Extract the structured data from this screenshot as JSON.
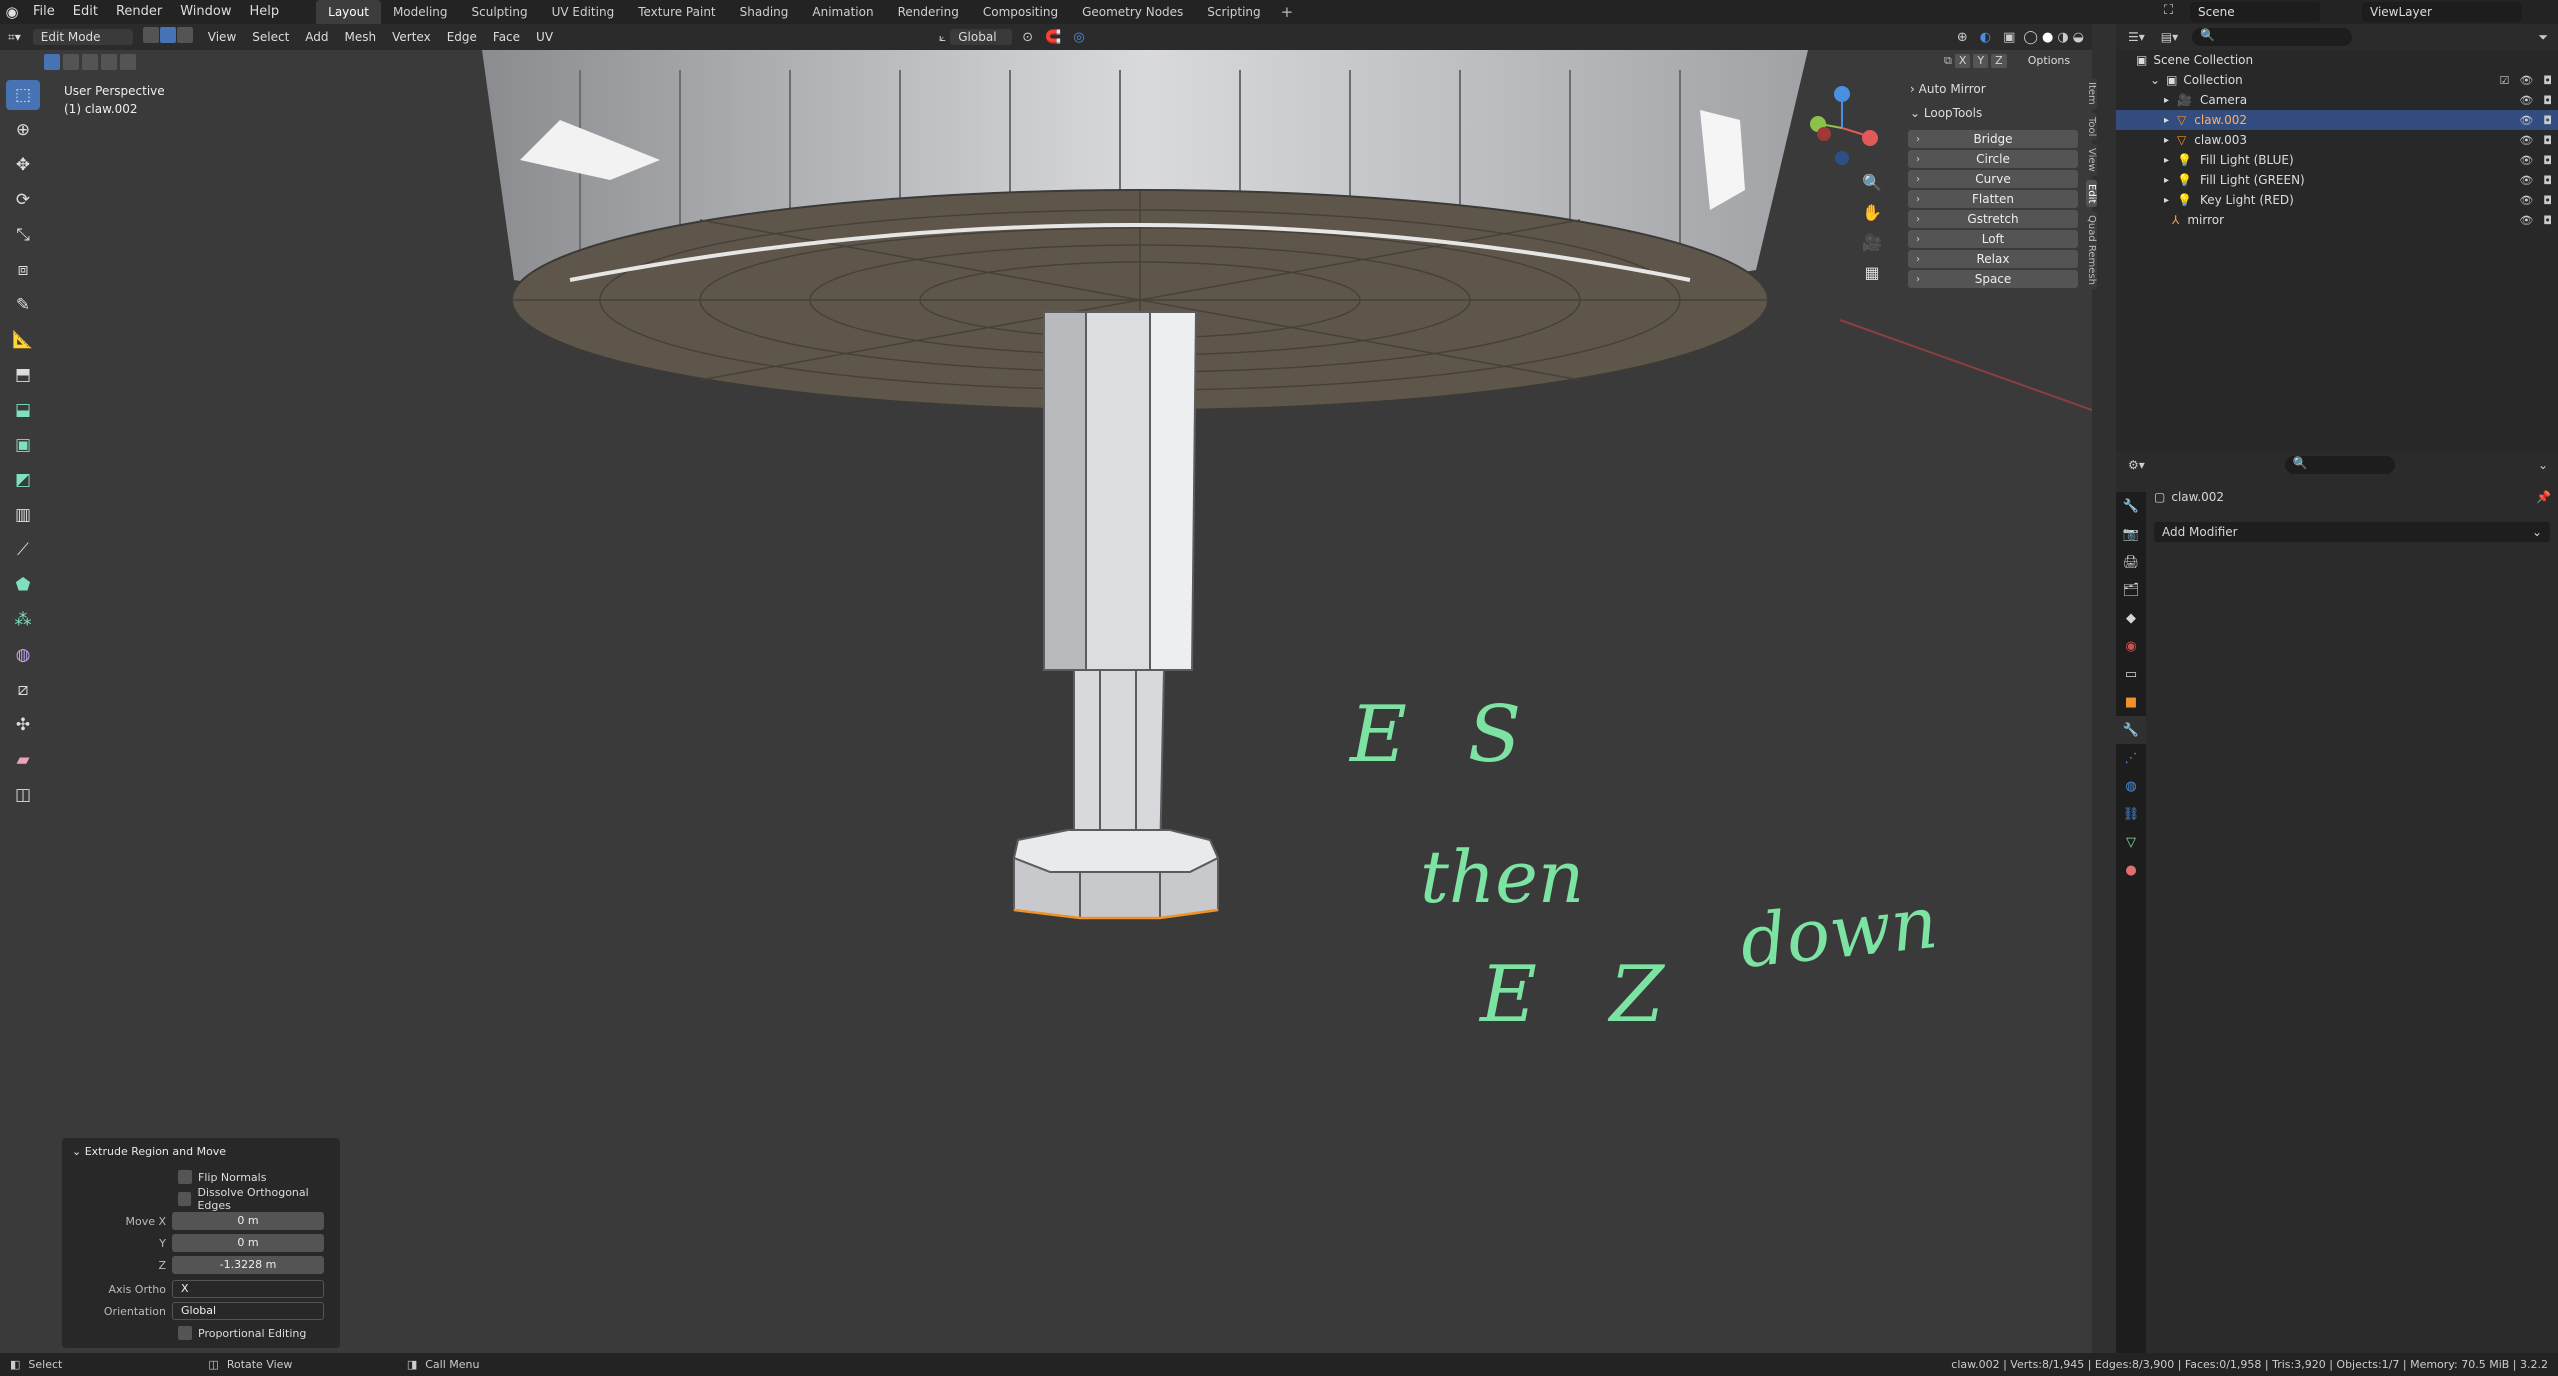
{
  "topbar": {
    "menus": [
      "File",
      "Edit",
      "Render",
      "Window",
      "Help"
    ],
    "workspaces": [
      "Layout",
      "Modeling",
      "Sculpting",
      "UV Editing",
      "Texture Paint",
      "Shading",
      "Animation",
      "Rendering",
      "Compositing",
      "Geometry Nodes",
      "Scripting"
    ],
    "active_workspace": "Layout",
    "scene": "Scene",
    "view_layer": "ViewLayer"
  },
  "viewport_header": {
    "mode": "Edit Mode",
    "menus": [
      "View",
      "Select",
      "Add",
      "Mesh",
      "Vertex",
      "Edge",
      "Face",
      "UV"
    ],
    "orientation": "Global",
    "axes": [
      "X",
      "Y",
      "Z"
    ],
    "options_label": "Options"
  },
  "viewport": {
    "perspective": "User Perspective",
    "object_label": "(1) claw.002",
    "annotations": [
      "E S",
      "then",
      "E Z",
      "down"
    ],
    "annotation_color": "#7de3a3"
  },
  "sidebar": {
    "auto_mirror": "Auto Mirror",
    "looptools_title": "LoopTools",
    "looptools": [
      "Bridge",
      "Circle",
      "Curve",
      "Flatten",
      "Gstretch",
      "Loft",
      "Relax",
      "Space"
    ],
    "tabs": [
      "Item",
      "Tool",
      "View",
      "Edit",
      "Quad Remesh"
    ]
  },
  "operator_panel": {
    "title": "Extrude Region and Move",
    "flip_normals": "Flip Normals",
    "dissolve": "Dissolve Orthogonal Edges",
    "move_x_label": "Move X",
    "move_x": "0 m",
    "y_label": "Y",
    "move_y": "0 m",
    "z_label": "Z",
    "move_z": "-1.3228 m",
    "axis_ortho_label": "Axis Ortho",
    "axis_ortho": "X",
    "orientation_label": "Orientation",
    "orientation": "Global",
    "proportional": "Proportional Editing"
  },
  "outliner": {
    "scene_collection": "Scene Collection",
    "collection": "Collection",
    "items": [
      {
        "name": "Camera",
        "icon": "camera-icon",
        "selected": false
      },
      {
        "name": "claw.002",
        "icon": "mesh-icon",
        "selected": true
      },
      {
        "name": "claw.003",
        "icon": "mesh-icon",
        "selected": false
      },
      {
        "name": "Fill Light (BLUE)",
        "icon": "light-icon",
        "selected": false
      },
      {
        "name": "Fill Light (GREEN)",
        "icon": "light-icon",
        "selected": false
      },
      {
        "name": "Key Light (RED)",
        "icon": "light-icon",
        "selected": false
      },
      {
        "name": "mirror",
        "icon": "empty-icon",
        "selected": false
      }
    ]
  },
  "properties": {
    "object_name": "claw.002",
    "add_modifier": "Add Modifier"
  },
  "statusbar": {
    "select": "Select",
    "rotate": "Rotate View",
    "call_menu": "Call Menu",
    "stats": "claw.002 | Verts:8/1,945 | Edges:8/3,900 | Faces:0/1,958 | Tris:3,920 | Objects:1/7 | Memory: 70.5 MiB | 3.2.2"
  },
  "colors": {
    "accent": "#4772b3",
    "outliner_selected": "#334d80",
    "x_axis": "#e05a5a",
    "y_axis": "#8bc34a",
    "z_axis": "#4a90e2"
  }
}
